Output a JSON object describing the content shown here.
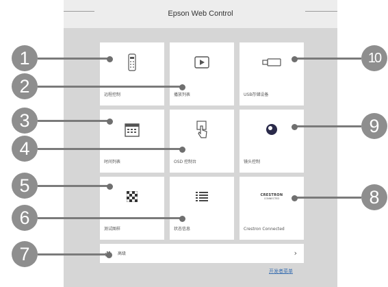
{
  "header": {
    "title": "Epson Web Control"
  },
  "tiles": [
    {
      "label": "远程控制",
      "icon": "remote-control-icon"
    },
    {
      "label": "播放列表",
      "icon": "play-icon"
    },
    {
      "label": "USB存储设备",
      "icon": "usb-icon"
    },
    {
      "label": "时间列表",
      "icon": "calendar-icon"
    },
    {
      "label": "OSD 控制台",
      "icon": "touch-hand-icon"
    },
    {
      "label": "镜头控制",
      "icon": "lens-icon"
    },
    {
      "label": "测试图样",
      "icon": "test-pattern-icon"
    },
    {
      "label": "状态信息",
      "icon": "list-icon"
    },
    {
      "label": "Crestron Connected",
      "icon": "crestron-logo",
      "logo_text": "CRESTRON",
      "logo_sub": "CONNECTED"
    }
  ],
  "advanced": {
    "label": "高级",
    "icon": "gear-icon",
    "chevron": "›"
  },
  "developer_link": "开发者菜单",
  "callouts": [
    "1",
    "2",
    "3",
    "4",
    "5",
    "6",
    "7",
    "8",
    "9",
    "10"
  ]
}
